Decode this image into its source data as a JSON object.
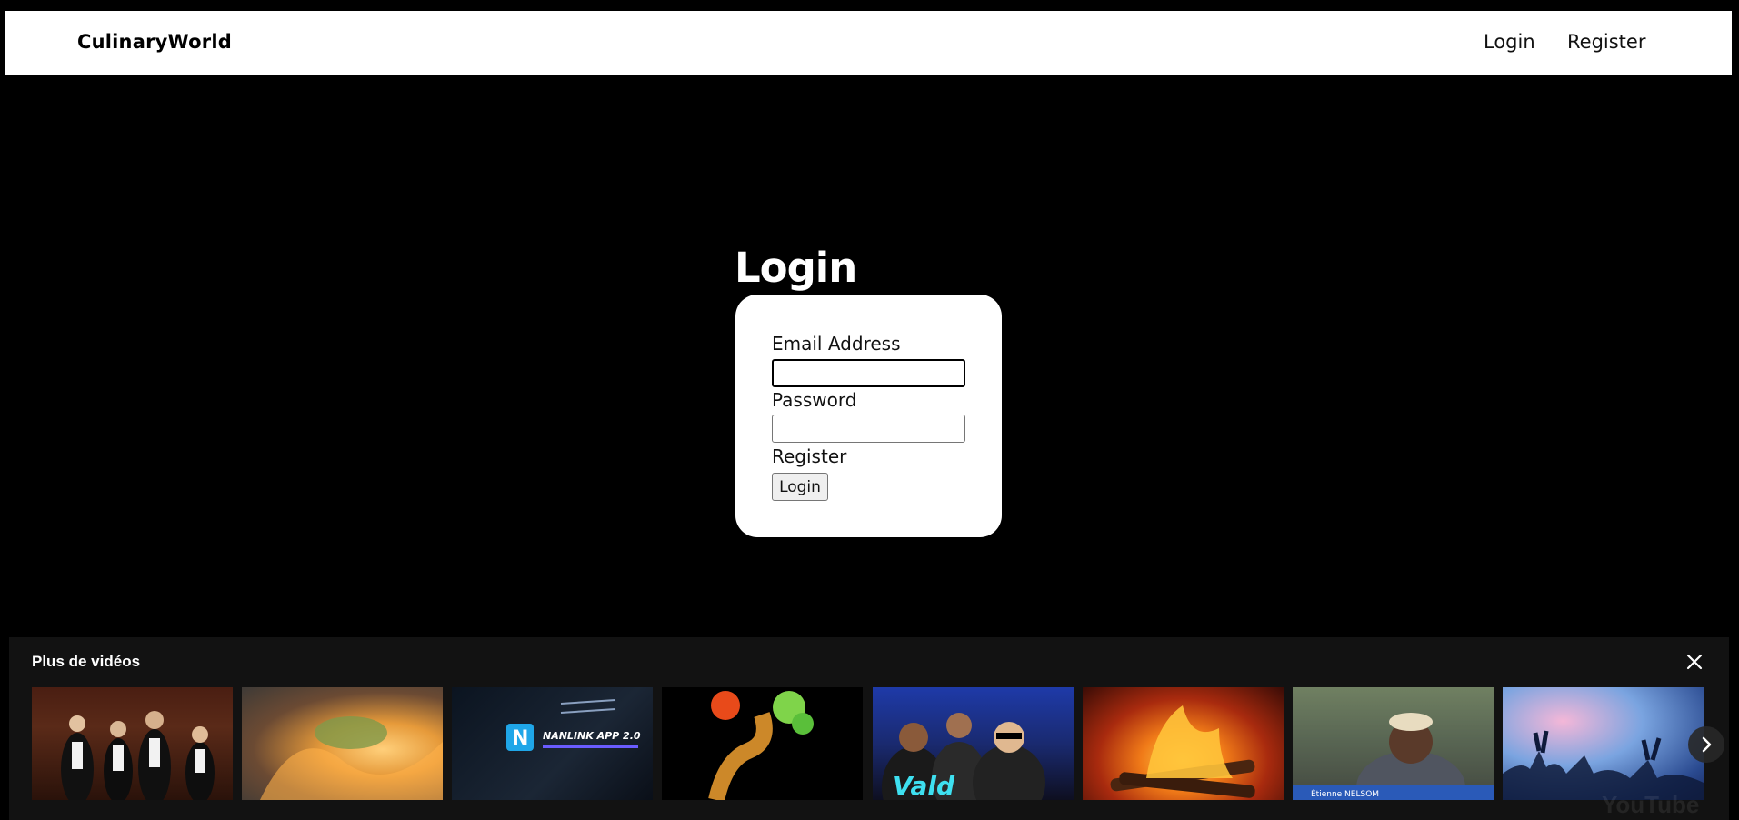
{
  "navbar": {
    "brand": "CulinaryWorld",
    "links": [
      "Login",
      "Register"
    ]
  },
  "login": {
    "title": "Login",
    "email_label": "Email Address",
    "email_value": "",
    "password_label": "Password",
    "password_value": "",
    "register_link": "Register",
    "submit_label": "Login"
  },
  "videos_panel": {
    "title": "Plus de vidéos",
    "close_icon": "close-icon",
    "next_icon": "chevron-right-icon",
    "thumbnails": [
      {
        "id": "video-1",
        "text": ""
      },
      {
        "id": "video-2",
        "text": ""
      },
      {
        "id": "video-3",
        "text": "NANLINK APP 2.0"
      },
      {
        "id": "video-4",
        "text": ""
      },
      {
        "id": "video-5",
        "text": "Vald"
      },
      {
        "id": "video-6",
        "text": ""
      },
      {
        "id": "video-7",
        "text": "Étienne NELSOM"
      },
      {
        "id": "video-8",
        "text": ""
      }
    ],
    "watermark": "YouTube"
  }
}
